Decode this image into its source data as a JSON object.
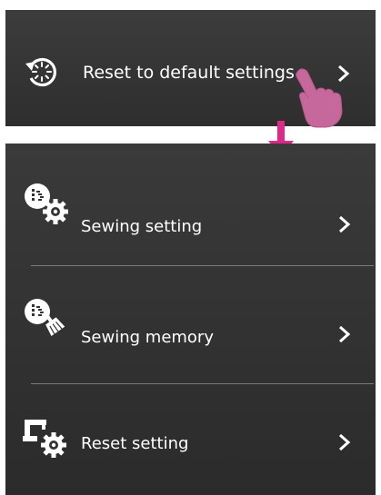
{
  "top_panel": {
    "label": "Reset to default settings",
    "icon": "reset-clock-icon"
  },
  "menu": {
    "items": [
      {
        "label": "Sewing setting",
        "icon": "sewing-setting-icon"
      },
      {
        "label": "Sewing memory",
        "icon": "sewing-memory-icon"
      },
      {
        "label": "Reset setting",
        "icon": "reset-setting-icon"
      }
    ]
  },
  "colors": {
    "panel_background": "#333333",
    "text": "#ffffff",
    "accent_arrow": "#e0288a",
    "hand": "#c7689c"
  }
}
